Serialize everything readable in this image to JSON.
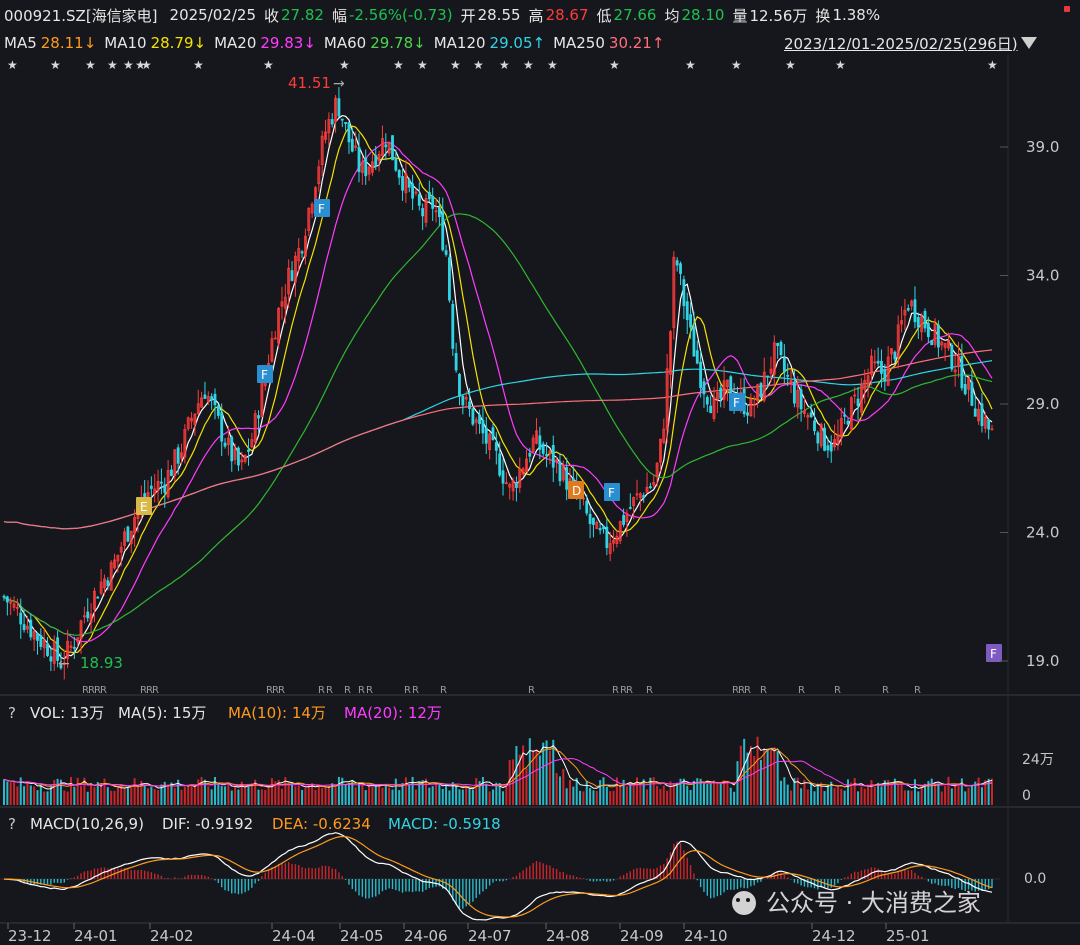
{
  "header": {
    "symbol": "000921.SZ[海信家电]",
    "date": "2025/02/25",
    "close_label": "收",
    "close": "27.82",
    "change_label": "幅",
    "change": "-2.56%(-0.73)",
    "open_label": "开",
    "open": "28.55",
    "high_label": "高",
    "high": "28.67",
    "low_label": "低",
    "low": "27.66",
    "avg_label": "均",
    "avg": "28.10",
    "vol_label": "量",
    "vol": "12.56万",
    "turnover_label": "换",
    "turnover": "1.38%"
  },
  "ma_row": {
    "ma5": "MA5",
    "ma5_val": "28.11↓",
    "ma10": "MA10",
    "ma10_val": "28.79↓",
    "ma20": "MA20",
    "ma20_val": "29.83↓",
    "ma60": "MA60",
    "ma60_val": "29.78↓",
    "ma120": "MA120",
    "ma120_val": "29.05↑",
    "ma250": "MA250",
    "ma250_val": "30.21↑",
    "range": "2023/12/01-2025/02/25(296日)"
  },
  "price_panel": {
    "y_ticks": [
      "39.0",
      "34.0",
      "29.0",
      "24.0",
      "19.0"
    ],
    "high_mark": "41.51",
    "low_mark": "18.93",
    "badges": [
      "E",
      "F",
      "F",
      "D",
      "F",
      "F",
      "F"
    ]
  },
  "vol_panel": {
    "q": "?",
    "label": "VOL: 13万",
    "ma5": "MA(5): 15万",
    "ma10": "MA(10): 14万",
    "ma20": "MA(20): 12万",
    "y_ticks": [
      "24万",
      "0"
    ]
  },
  "macd_panel": {
    "q": "?",
    "label": "MACD(10,26,9)",
    "dif": "DIF: -0.9192",
    "dea": "DEA: -0.6234",
    "macd": "MACD: -0.5918",
    "y_tick": "0.0"
  },
  "x_axis": [
    "23-12",
    "24-01",
    "24-02",
    "24-04",
    "24-05",
    "24-06",
    "24-07",
    "24-08",
    "24-09",
    "24-10",
    "24-12",
    "25-01"
  ],
  "watermark": "公众号 · 大消费之家",
  "chart_data": {
    "type": "candlestick",
    "title": "000921.SZ[海信家电]",
    "x_range": [
      "2023/12/01",
      "2025/02/25"
    ],
    "sessions": 296,
    "ylim": [
      18,
      42
    ],
    "y_ticks": [
      19,
      24,
      29,
      34,
      39
    ],
    "max_price": 41.51,
    "min_price": 18.93,
    "moving_averages": [
      {
        "name": "MA5",
        "value": 28.11,
        "color": "#ffffff"
      },
      {
        "name": "MA10",
        "value": 28.79,
        "color": "#f5e200"
      },
      {
        "name": "MA20",
        "value": 29.83,
        "color": "#ff3cff"
      },
      {
        "name": "MA60",
        "value": 29.78,
        "color": "#2fb830"
      },
      {
        "name": "MA120",
        "value": 29.05,
        "color": "#30d5e5"
      },
      {
        "name": "MA250",
        "value": 30.21,
        "color": "#ff6f7a"
      }
    ],
    "close_path": [
      [
        0,
        21.5
      ],
      [
        4,
        20.8
      ],
      [
        8,
        20.0
      ],
      [
        12,
        19.4
      ],
      [
        14,
        18.93
      ],
      [
        17,
        19.6
      ],
      [
        20,
        20.8
      ],
      [
        24,
        22.0
      ],
      [
        27,
        22.6
      ],
      [
        30,
        23.8
      ],
      [
        33,
        24.8
      ],
      [
        36,
        25.6
      ],
      [
        40,
        26.0
      ],
      [
        44,
        27.2
      ],
      [
        47,
        28.6
      ],
      [
        50,
        29.6
      ],
      [
        53,
        28.4
      ],
      [
        56,
        27.2
      ],
      [
        59,
        26.4
      ],
      [
        62,
        27.8
      ],
      [
        65,
        30.2
      ],
      [
        68,
        32.4
      ],
      [
        71,
        34.0
      ],
      [
        74,
        35.2
      ],
      [
        77,
        37.4
      ],
      [
        80,
        39.6
      ],
      [
        83,
        40.8
      ],
      [
        86,
        39.2
      ],
      [
        89,
        38.0
      ],
      [
        92,
        38.6
      ],
      [
        95,
        39.4
      ],
      [
        98,
        38.2
      ],
      [
        101,
        37.2
      ],
      [
        104,
        36.4
      ],
      [
        107,
        36.8
      ],
      [
        110,
        35.0
      ],
      [
        112,
        31.0
      ],
      [
        114,
        29.2
      ],
      [
        117,
        28.4
      ],
      [
        120,
        27.6
      ],
      [
        123,
        26.8
      ],
      [
        126,
        25.6
      ],
      [
        129,
        26.6
      ],
      [
        132,
        27.6
      ],
      [
        135,
        27.0
      ],
      [
        138,
        26.6
      ],
      [
        141,
        25.8
      ],
      [
        144,
        25.0
      ],
      [
        147,
        24.0
      ],
      [
        150,
        23.6
      ],
      [
        153,
        24.2
      ],
      [
        156,
        25.0
      ],
      [
        159,
        25.6
      ],
      [
        162,
        26.0
      ],
      [
        164,
        27.8
      ],
      [
        166,
        32.0
      ],
      [
        167,
        35.0
      ],
      [
        169,
        33.2
      ],
      [
        171,
        31.6
      ],
      [
        174,
        29.8
      ],
      [
        177,
        28.8
      ],
      [
        180,
        29.6
      ],
      [
        183,
        29.2
      ],
      [
        186,
        28.8
      ],
      [
        189,
        29.8
      ],
      [
        192,
        31.0
      ],
      [
        195,
        30.0
      ],
      [
        198,
        29.0
      ],
      [
        201,
        28.4
      ],
      [
        204,
        27.6
      ],
      [
        207,
        27.4
      ],
      [
        210,
        28.6
      ],
      [
        213,
        29.4
      ],
      [
        216,
        30.4
      ],
      [
        219,
        30.2
      ],
      [
        222,
        31.2
      ],
      [
        225,
        33.0
      ],
      [
        228,
        32.4
      ],
      [
        231,
        31.8
      ],
      [
        234,
        31.2
      ],
      [
        237,
        30.6
      ],
      [
        240,
        29.6
      ],
      [
        243,
        28.6
      ],
      [
        246,
        27.82
      ]
    ],
    "volume": {
      "current": "13万",
      "ma5": "15万",
      "ma10": "14万",
      "ma20": "12万"
    },
    "macd": {
      "params": "10,26,9",
      "dif": -0.9192,
      "dea": -0.6234,
      "macd": -0.5918
    }
  }
}
